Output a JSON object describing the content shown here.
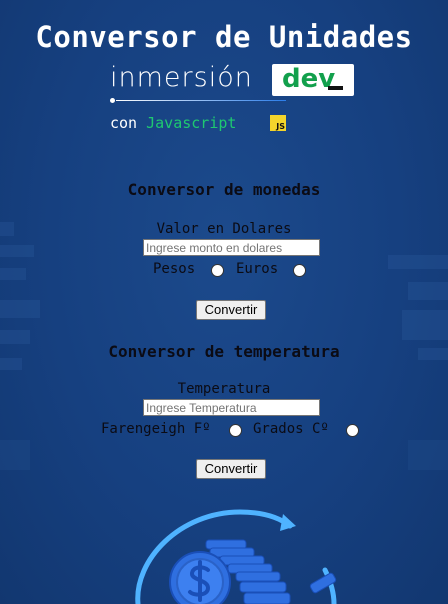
{
  "header": {
    "title": "Conversor de Unidades",
    "brand_word": "inmersión",
    "brand_highlight": "dev",
    "byline_prefix": "con",
    "byline_language": "Javascript",
    "badge": "JS"
  },
  "currency": {
    "heading": "Conversor de monedas",
    "input_label": "Valor en Dolares",
    "input_placeholder": "Ingrese monto en dolares",
    "option_1": "Pesos",
    "option_2": "Euros",
    "button": "Convertir"
  },
  "temperature": {
    "heading": "Conversor de temperatura",
    "input_label": "Temperatura",
    "input_placeholder": "Ingrese Temperatura",
    "option_1": "Farengeigh Fº",
    "option_2": "Grados Cº",
    "button": "Convertir"
  },
  "colors": {
    "background": "#17427f",
    "brand_green": "#12a04c",
    "js_green": "#1ec871",
    "js_badge": "#f3d52c"
  }
}
